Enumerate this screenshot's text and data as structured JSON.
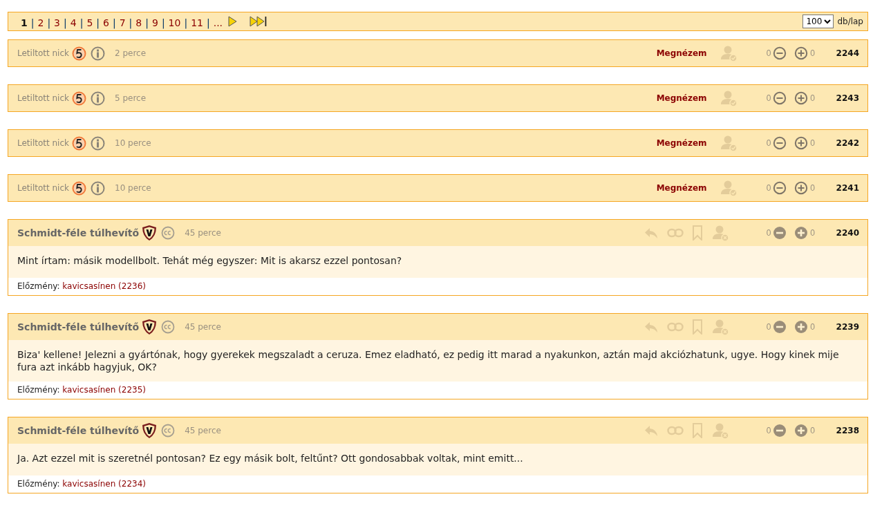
{
  "pager": {
    "pages": [
      {
        "label": "1",
        "selected": true
      },
      {
        "label": "2",
        "selected": false
      },
      {
        "label": "3",
        "selected": false
      },
      {
        "label": "4",
        "selected": false
      },
      {
        "label": "5",
        "selected": false
      },
      {
        "label": "6",
        "selected": false
      },
      {
        "label": "7",
        "selected": false
      },
      {
        "label": "8",
        "selected": false
      },
      {
        "label": "9",
        "selected": false
      },
      {
        "label": "10",
        "selected": false
      },
      {
        "label": "11",
        "selected": false
      },
      {
        "label": "...",
        "selected": false
      }
    ],
    "separator": "|",
    "per_page": {
      "value": "100",
      "label": "db/lap"
    }
  },
  "posts": [
    {
      "kind": "blocked",
      "author": "Letiltott nick",
      "time": "2 perce",
      "view": "Megnézem",
      "minus": "0",
      "plus": "0",
      "number": "2244"
    },
    {
      "kind": "blocked",
      "author": "Letiltott nick",
      "time": "5 perce",
      "view": "Megnézem",
      "minus": "0",
      "plus": "0",
      "number": "2243"
    },
    {
      "kind": "blocked",
      "author": "Letiltott nick",
      "time": "10 perce",
      "view": "Megnézem",
      "minus": "0",
      "plus": "0",
      "number": "2242"
    },
    {
      "kind": "blocked",
      "author": "Letiltott nick",
      "time": "10 perce",
      "view": "Megnézem",
      "minus": "0",
      "plus": "0",
      "number": "2241"
    },
    {
      "kind": "comment",
      "author": "Schmidt-féle túlhevítő",
      "time": "45 perce",
      "minus": "0",
      "plus": "0",
      "number": "2240",
      "text": "Mint írtam: másik modellbolt. Tehát még egyszer: Mit is akarsz ezzel pontosan?",
      "history_label": "Előzmény:",
      "history_link": "kavicsasínen (2236)"
    },
    {
      "kind": "comment",
      "author": "Schmidt-féle túlhevítő",
      "time": "45 perce",
      "minus": "0",
      "plus": "0",
      "number": "2239",
      "text": "Biza' kellene! Jelezni a gyártónak, hogy gyerekek megszaladt a ceruza. Emez eladható, ez pedig itt marad a nyakunkon, aztán majd akciózhatunk, ugye. Hogy kinek mije fura azt inkább hagyjuk, OK?",
      "history_label": "Előzmény:",
      "history_link": "kavicsasínen (2235)"
    },
    {
      "kind": "comment",
      "author": "Schmidt-féle túlhevítő",
      "time": "45 perce",
      "minus": "0",
      "plus": "0",
      "number": "2238",
      "text": "Ja. Azt ezzel mit is szeretnél pontosan? Ez egy másik bolt, feltűnt? Ott gondosabbak voltak, mint emitt...",
      "history_label": "Előzmény:",
      "history_link": "kavicsasínen (2234)"
    }
  ]
}
